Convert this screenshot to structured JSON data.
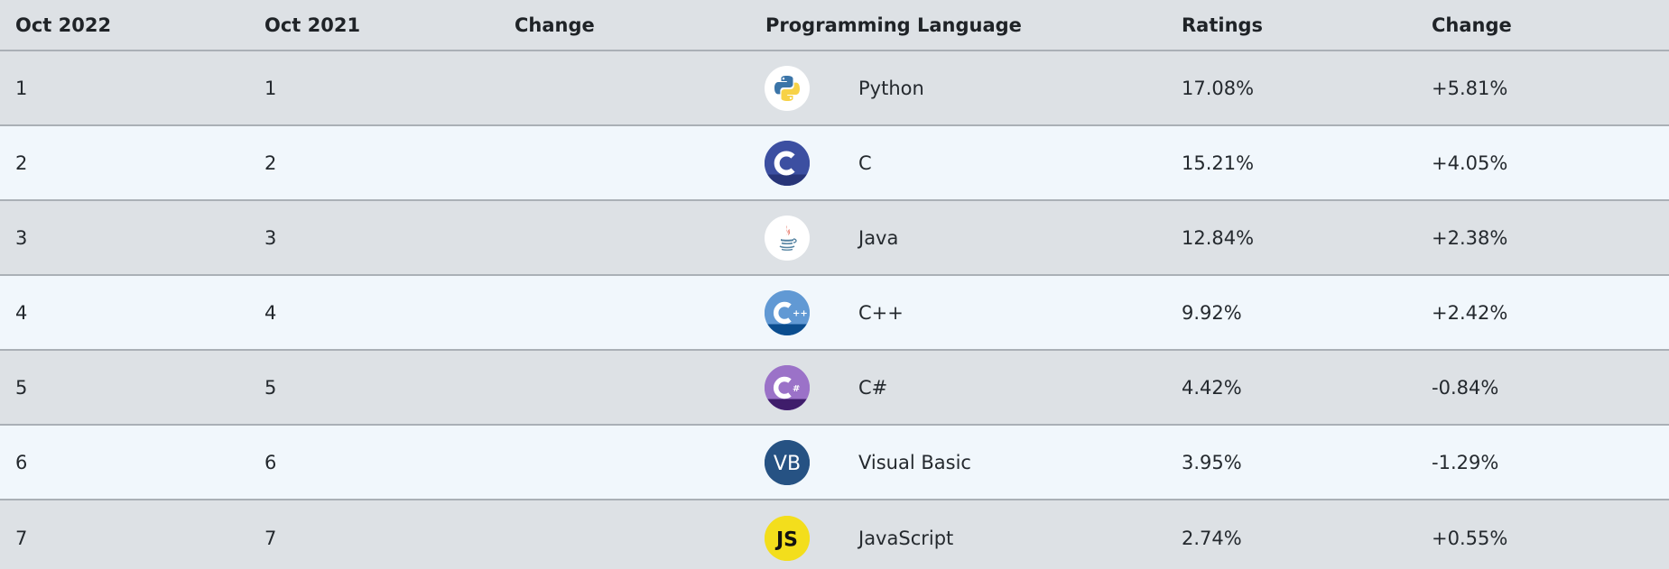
{
  "headers": {
    "current": "Oct 2022",
    "previous": "Oct 2021",
    "change": "Change",
    "language": "Programming Language",
    "ratings": "Ratings",
    "ratings_change": "Change"
  },
  "rows": [
    {
      "current": "1",
      "previous": "1",
      "language": "Python",
      "ratings": "17.08%",
      "change": "+5.81%",
      "icon": "python-icon"
    },
    {
      "current": "2",
      "previous": "2",
      "language": "C",
      "ratings": "15.21%",
      "change": "+4.05%",
      "icon": "c-icon"
    },
    {
      "current": "3",
      "previous": "3",
      "language": "Java",
      "ratings": "12.84%",
      "change": "+2.38%",
      "icon": "java-icon"
    },
    {
      "current": "4",
      "previous": "4",
      "language": "C++",
      "ratings": "9.92%",
      "change": "+2.42%",
      "icon": "cpp-icon"
    },
    {
      "current": "5",
      "previous": "5",
      "language": "C#",
      "ratings": "4.42%",
      "change": "-0.84%",
      "icon": "csharp-icon"
    },
    {
      "current": "6",
      "previous": "6",
      "language": "Visual Basic",
      "ratings": "3.95%",
      "change": "-1.29%",
      "icon": "visual-basic-icon"
    },
    {
      "current": "7",
      "previous": "7",
      "language": "JavaScript",
      "ratings": "2.74%",
      "change": "+0.55%",
      "icon": "javascript-icon"
    }
  ],
  "icon_labels": {
    "vb": "VB",
    "js": "JS"
  },
  "colors": {
    "header_bg": "#dde1e5",
    "odd_row_bg": "#dde1e5",
    "even_row_bg": "#f1f7fc",
    "divider": "#aab0b6"
  }
}
